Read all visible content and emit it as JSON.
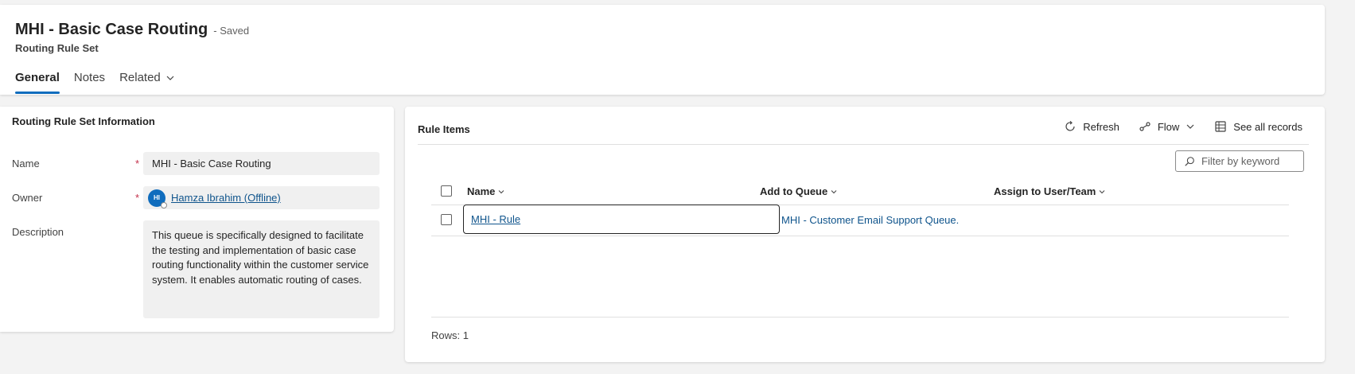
{
  "header": {
    "title": "MHI - Basic Case Routing",
    "saved_status": "- Saved",
    "entity_name": "Routing Rule Set",
    "tabs": [
      {
        "label": "General"
      },
      {
        "label": "Notes"
      },
      {
        "label": "Related"
      }
    ]
  },
  "info": {
    "section_title": "Routing Rule Set Information",
    "name": {
      "label": "Name",
      "required": "*",
      "value": "MHI - Basic Case Routing"
    },
    "owner": {
      "label": "Owner",
      "required": "*",
      "initials": "HI",
      "value": "Hamza Ibrahim (Offline)"
    },
    "description": {
      "label": "Description",
      "value": "This queue is specifically designed to facilitate the testing and implementation of basic case routing functionality within the customer service system. It enables automatic routing of cases."
    }
  },
  "rules": {
    "title": "Rule Items",
    "commands": {
      "refresh": "Refresh",
      "flow": "Flow",
      "see_all": "See all records"
    },
    "filter_placeholder": "Filter by keyword",
    "columns": {
      "name": "Name",
      "queue": "Add to Queue",
      "assign": "Assign to User/Team"
    },
    "rows": [
      {
        "name": "MHI - Rule",
        "queue": "MHI - Customer Email Support Queue.",
        "assign": ""
      }
    ],
    "rows_count": "Rows: 1"
  },
  "colors": {
    "accent": "#0f6cbd",
    "link": "#0f548c",
    "required": "#c4314b"
  },
  "icons": [
    "chevron-down-icon",
    "refresh-icon",
    "flow-icon",
    "grid-icon",
    "search-icon"
  ]
}
